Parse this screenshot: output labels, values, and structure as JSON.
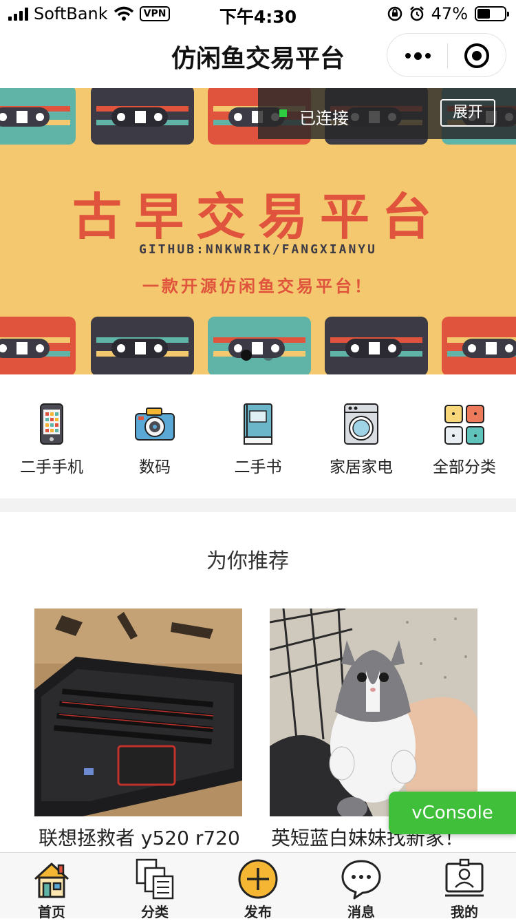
{
  "status_bar": {
    "carrier": "SoftBank",
    "vpn": "VPN",
    "time": "下午4:30",
    "battery": "47%",
    "battery_level": 0.47
  },
  "nav": {
    "title": "仿闲鱼交易平台"
  },
  "banner": {
    "title": "古早交易平台",
    "github": "GITHUB:NNKWRIK/FANGXIANYU",
    "subtitle": "一款开源仿闲鱼交易平台！",
    "slide_count": 2,
    "active_slide": 1
  },
  "connection": {
    "status": "已连接",
    "expand_label": "展开"
  },
  "categories": [
    {
      "label": "二手手机",
      "icon": "phone-icon"
    },
    {
      "label": "数码",
      "icon": "camera-icon"
    },
    {
      "label": "二手书",
      "icon": "book-icon"
    },
    {
      "label": "家居家电",
      "icon": "washing-machine-icon"
    },
    {
      "label": "全部分类",
      "icon": "grid-icon"
    }
  ],
  "recommend": {
    "title": "为你推荐",
    "products": [
      {
        "title": "联想拯救者 y520 r720",
        "image": "laptop-photo"
      },
      {
        "title": "英短蓝白妹妹找新家！",
        "image": "kitten-photo"
      }
    ]
  },
  "vconsole": {
    "label": "vConsole"
  },
  "tabbar": [
    {
      "label": "首页",
      "icon": "home-icon"
    },
    {
      "label": "分类",
      "icon": "category-icon"
    },
    {
      "label": "发布",
      "icon": "publish-plus-icon"
    },
    {
      "label": "消息",
      "icon": "message-icon"
    },
    {
      "label": "我的",
      "icon": "profile-icon"
    }
  ],
  "colors": {
    "banner_bg": "#f3c86e",
    "banner_accent": "#e0533c",
    "vconsole_green": "#3fbf3a",
    "publish_yellow": "#f5b733"
  }
}
